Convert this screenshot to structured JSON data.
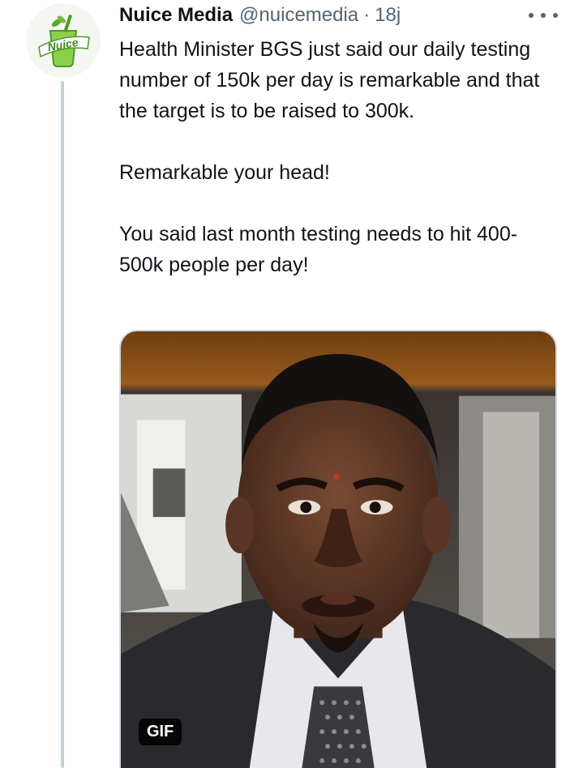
{
  "tweet": {
    "author_name": "Nuice Media",
    "author_handle": "@nuicemedia",
    "separator": "·",
    "time": "18j",
    "avatar_text": "Nuice",
    "paragraphs": [
      "Health Minister BGS just said our daily testing number of 150k per day is remarkable and that the target is to be raised to 300k.",
      "Remarkable your head!",
      "You said last month testing needs to hit 400-500k people per day!"
    ],
    "media": {
      "badge": "GIF"
    }
  },
  "icons": {
    "more": "more-horizontal-icon",
    "avatar": "nuice-logo"
  },
  "colors": {
    "text": "#0f1419",
    "secondary": "#536471",
    "thread_line": "#c4cfd6",
    "brand_green": "#5aa832"
  }
}
